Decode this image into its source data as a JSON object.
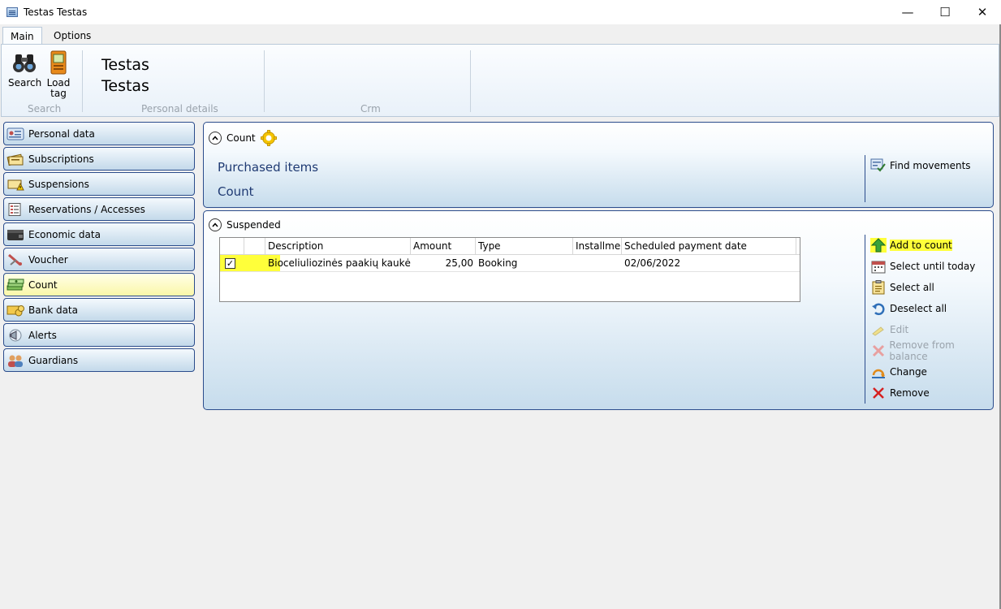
{
  "window": {
    "title": "Testas Testas",
    "minimize": "—",
    "maximize": "☐",
    "close": "✕"
  },
  "ribbon": {
    "tabs": [
      {
        "label": "Main"
      },
      {
        "label": "Options"
      }
    ],
    "search_label": "Search",
    "load_tag_line1": "Load",
    "load_tag_line2": "tag",
    "group_search": "Search",
    "group_personal": "Personal details",
    "group_crm": "Crm",
    "person_first": "Testas",
    "person_last": "Testas"
  },
  "nav": {
    "items": [
      {
        "label": "Personal data"
      },
      {
        "label": "Subscriptions"
      },
      {
        "label": "Suspensions"
      },
      {
        "label": "Reservations / Accesses"
      },
      {
        "label": "Economic data"
      },
      {
        "label": "Voucher"
      },
      {
        "label": "Count"
      },
      {
        "label": "Bank data"
      },
      {
        "label": "Alerts"
      },
      {
        "label": "Guardians"
      }
    ],
    "selected_index": 6
  },
  "count_panel": {
    "title": "Count",
    "purchased_items": "Purchased items",
    "count_label": "Count",
    "find_movements": "Find movements"
  },
  "suspended_panel": {
    "title": "Suspended",
    "columns": [
      "",
      "",
      "Description",
      "Amount",
      "Type",
      "Installmen",
      "Scheduled payment date"
    ],
    "rows": [
      {
        "checked": "✓",
        "description": "Bioceliuliozinės paakių kaukės užc",
        "amount": "25,00",
        "type": "Booking",
        "installment": "",
        "date": "02/06/2022"
      }
    ],
    "actions": {
      "add_to_count": "Add to count",
      "select_until_today": "Select until today",
      "select_all": "Select all",
      "deselect_all": "Deselect all",
      "edit": "Edit",
      "remove_from_balance": "Remove from balance",
      "change": "Change",
      "remove": "Remove"
    }
  },
  "colors": {
    "accent_border": "#2b4c8c",
    "highlight": "#ffff3a",
    "selected_nav": "#fbf7a8"
  }
}
